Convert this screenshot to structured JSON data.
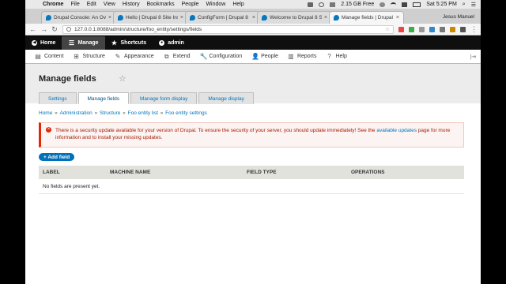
{
  "os_menubar": {
    "app": "Chrome",
    "items": [
      "File",
      "Edit",
      "View",
      "History",
      "Bookmarks",
      "People",
      "Window",
      "Help"
    ],
    "storage": "2.15 GB Free",
    "clock": "Sat 5:25 PM"
  },
  "browser": {
    "tabs": [
      {
        "title": "Drupal Console: An Overvi",
        "active": false
      },
      {
        "title": "Hello | Drupal 8 Site Install",
        "active": false
      },
      {
        "title": "ConfigForm | Drupal 8 Site",
        "active": false
      },
      {
        "title": "Welcome to Drupal 8 Site",
        "active": false
      },
      {
        "title": "Manage fields | Drupal 8 Site",
        "active": true
      }
    ],
    "profile": "Jesus Manuel",
    "url": "127.0.0.1:8088/admin/structure/foo_entity/settings/fields"
  },
  "drupal_toolbar": {
    "home": "Home",
    "manage": "Manage",
    "shortcuts": "Shortcuts",
    "user": "admin",
    "tray": [
      "Content",
      "Structure",
      "Appearance",
      "Extend",
      "Configuration",
      "People",
      "Reports",
      "Help"
    ]
  },
  "page": {
    "title": "Manage fields",
    "tabs": [
      {
        "label": "Settings",
        "active": false
      },
      {
        "label": "Manage fields",
        "active": true
      },
      {
        "label": "Manage form display",
        "active": false
      },
      {
        "label": "Manage display",
        "active": false
      }
    ],
    "breadcrumb": [
      "Home",
      "Administration",
      "Structure",
      "Foo entity list",
      "Foo entity settings"
    ],
    "alert": {
      "text_before": "There is a security update available for your version of Drupal. To ensure the security of your server, you should update immediately! See the ",
      "link": "available updates",
      "text_after": " page for more information and to install your missing updates."
    },
    "add_button": "+ Add field",
    "table": {
      "columns": [
        "LABEL",
        "MACHINE NAME",
        "FIELD TYPE",
        "OPERATIONS"
      ],
      "empty": "No fields are present yet."
    }
  },
  "colors": {
    "link": "#0074bd",
    "button": "#0071b8",
    "error": "#e62600"
  }
}
